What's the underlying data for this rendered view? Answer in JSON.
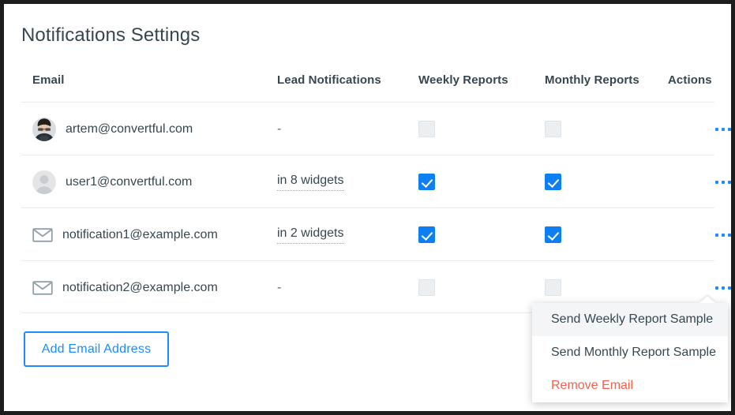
{
  "page": {
    "title": "Notifications Settings"
  },
  "table": {
    "columns": [
      {
        "key": "email",
        "label": "Email"
      },
      {
        "key": "lead",
        "label": "Lead Notifications"
      },
      {
        "key": "weekly",
        "label": "Weekly Reports"
      },
      {
        "key": "monthly",
        "label": "Monthly Reports"
      },
      {
        "key": "actions",
        "label": "Actions"
      }
    ],
    "rows": [
      {
        "email": "artem@convertful.com",
        "icon": "photo-avatar",
        "lead": "-",
        "lead_is_link": false,
        "weekly": false,
        "monthly": false,
        "actions": "more-options"
      },
      {
        "email": "user1@convertful.com",
        "icon": "placeholder-avatar",
        "lead": "in 8 widgets",
        "lead_is_link": true,
        "weekly": true,
        "monthly": true,
        "actions": "more-options"
      },
      {
        "email": "notification1@example.com",
        "icon": "envelope-icon",
        "lead": "in 2 widgets",
        "lead_is_link": true,
        "weekly": true,
        "monthly": true,
        "actions": "more-options"
      },
      {
        "email": "notification2@example.com",
        "icon": "envelope-icon",
        "lead": "-",
        "lead_is_link": false,
        "weekly": false,
        "monthly": false,
        "actions": "more-options"
      }
    ]
  },
  "buttons": {
    "add_email": "Add Email Address"
  },
  "dropdown": {
    "open_for_row": 4,
    "items": [
      {
        "label": "Send Weekly Report Sample",
        "style": "default",
        "hovered": true
      },
      {
        "label": "Send Monthly Report Sample",
        "style": "default",
        "hovered": false
      },
      {
        "label": "Remove Email",
        "style": "danger",
        "hovered": false
      }
    ]
  },
  "colors": {
    "accent_blue": "#1a8cff",
    "checkbox_blue": "#0d7ff2",
    "text_dark": "#37474f",
    "danger_red": "#f4604e",
    "border_gray": "#e8eaec",
    "checkbox_off": "#eceff1"
  }
}
